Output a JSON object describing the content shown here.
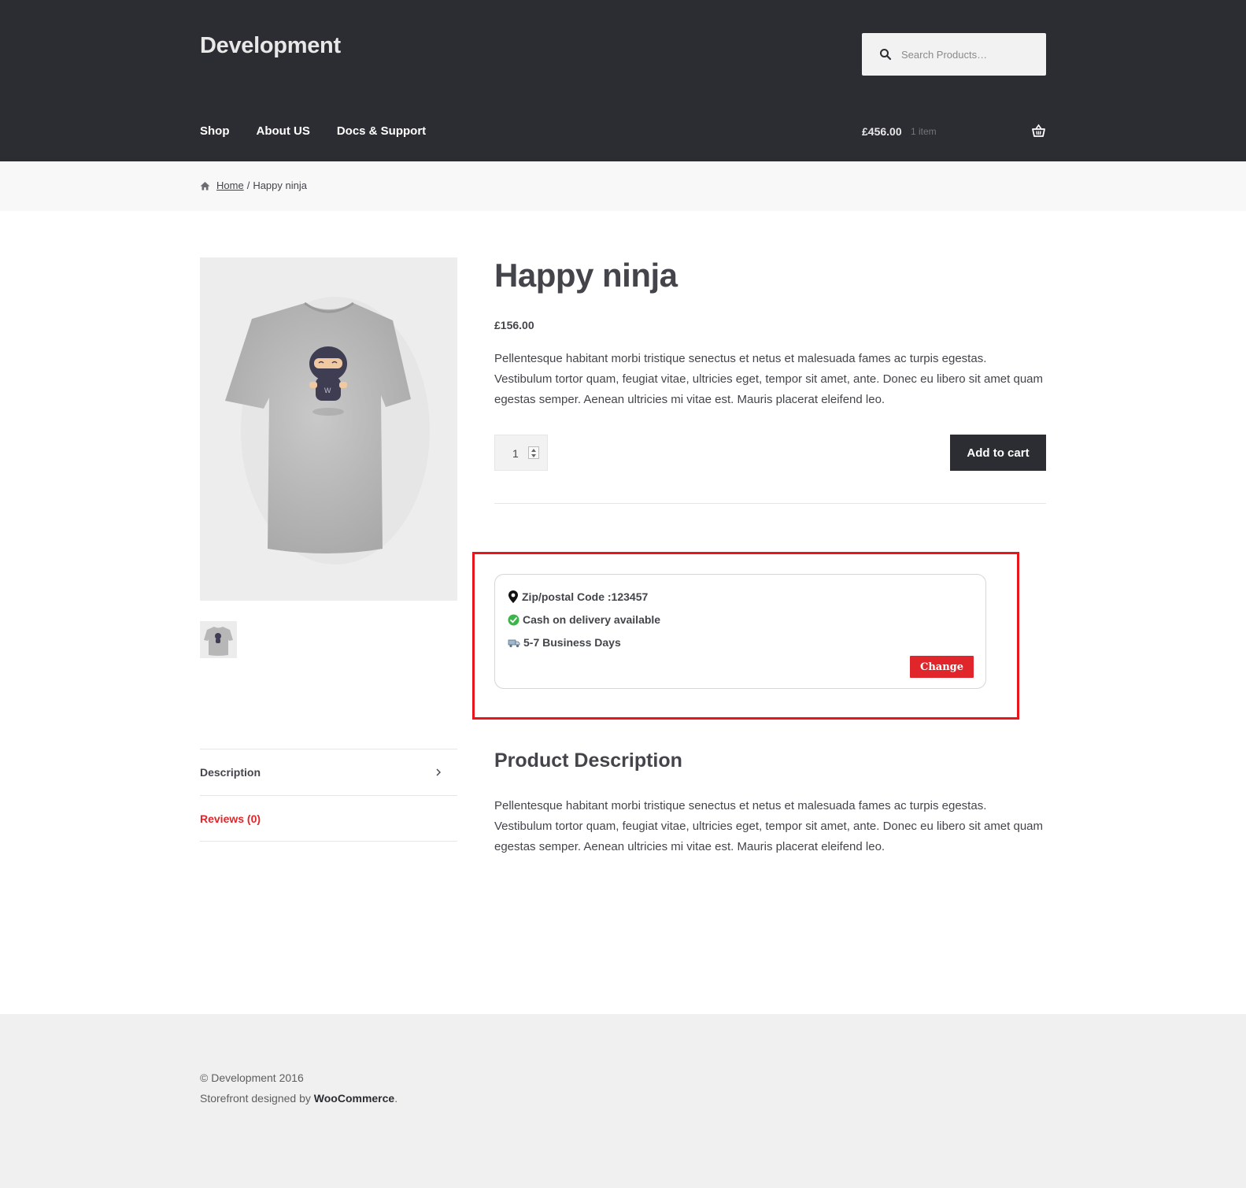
{
  "header": {
    "site_title": "Development",
    "search_placeholder": "Search Products…",
    "nav": [
      "Shop",
      "About US",
      "Docs & Support"
    ],
    "cart_total": "£456.00",
    "cart_count": "1 item"
  },
  "breadcrumb": {
    "home": "Home",
    "separator": "/",
    "current": "Happy ninja"
  },
  "product": {
    "title": "Happy ninja",
    "price": "£156.00",
    "short_description": "Pellentesque habitant morbi tristique senectus et netus et malesuada fames ac turpis egestas. Vestibulum tortor quam, feugiat vitae, ultricies eget, tempor sit amet, ante. Donec eu libero sit amet quam egestas semper. Aenean ultricies mi vitae est. Mauris placerat eleifend leo.",
    "quantity": "1",
    "add_to_cart": "Add to cart"
  },
  "cod": {
    "zip": "Zip/postal Code :123457",
    "availability": "Cash on delivery available",
    "delivery": "5-7 Business Days",
    "change_label": "Change"
  },
  "tabs": [
    "Description",
    "Reviews (0)"
  ],
  "description": {
    "title": "Product Description",
    "body": "Pellentesque habitant morbi tristique senectus et netus et malesuada fames ac turpis egestas. Vestibulum tortor quam, feugiat vitae, ultricies eget, tempor sit amet, ante. Donec eu libero sit amet quam egestas semper. Aenean ultricies mi vitae est. Mauris placerat eleifend leo."
  },
  "footer": {
    "copyright": "© Development 2016",
    "credit_prefix": "Storefront designed by ",
    "credit_link": "WooCommerce",
    "credit_suffix": "."
  },
  "colors": {
    "header_bg": "#2c2d33",
    "accent_red": "#e0262b",
    "highlight_border": "#e8151b",
    "text": "#43454b"
  },
  "icons": [
    "search-icon",
    "cart-icon",
    "home-icon",
    "location-pin-icon",
    "check-circle-icon",
    "delivery-truck-icon",
    "chevron-right-icon"
  ]
}
